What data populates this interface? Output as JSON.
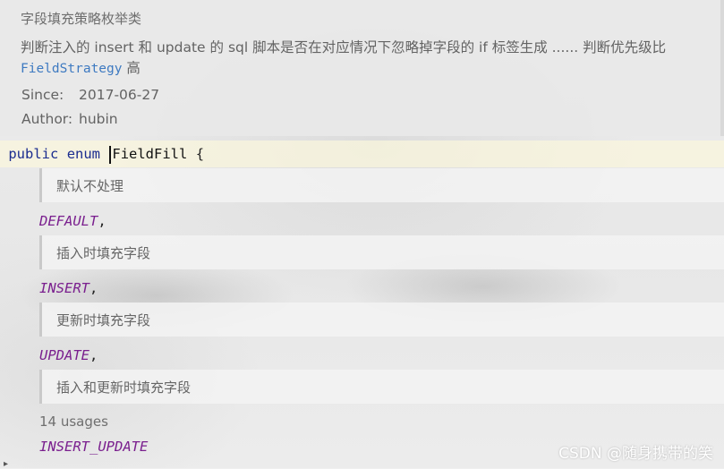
{
  "javadoc": {
    "summary": "字段填充策略枚举类",
    "description_prefix": "判断注入的 insert 和 update 的 sql 脚本是否在对应情况下忽略掉字段的 if 标签生成 ...... 判断优先级比",
    "description_link": "FieldStrategy",
    "description_suffix": " 高",
    "since_label": "Since:",
    "since_value": "2017-06-27",
    "author_label": "Author:",
    "author_value": "hubin"
  },
  "code": {
    "kw_public": "public",
    "kw_enum": "enum",
    "class_name": "FieldFill",
    "open_brace": "{",
    "constants": [
      {
        "doc": "默认不处理",
        "name": "DEFAULT",
        "suffix": ","
      },
      {
        "doc": "插入时填充字段",
        "name": "INSERT",
        "suffix": ","
      },
      {
        "doc": "更新时填充字段",
        "name": "UPDATE",
        "suffix": ","
      },
      {
        "doc": "插入和更新时填充字段",
        "name": "INSERT_UPDATE",
        "suffix": ""
      }
    ],
    "usages": "14 usages"
  },
  "watermark": "CSDN @随身携带的笑",
  "colors": {
    "keyword": "#1b2d8f",
    "constant": "#7a1f8e",
    "link": "#3e7ac1",
    "doc_text": "#636363"
  }
}
